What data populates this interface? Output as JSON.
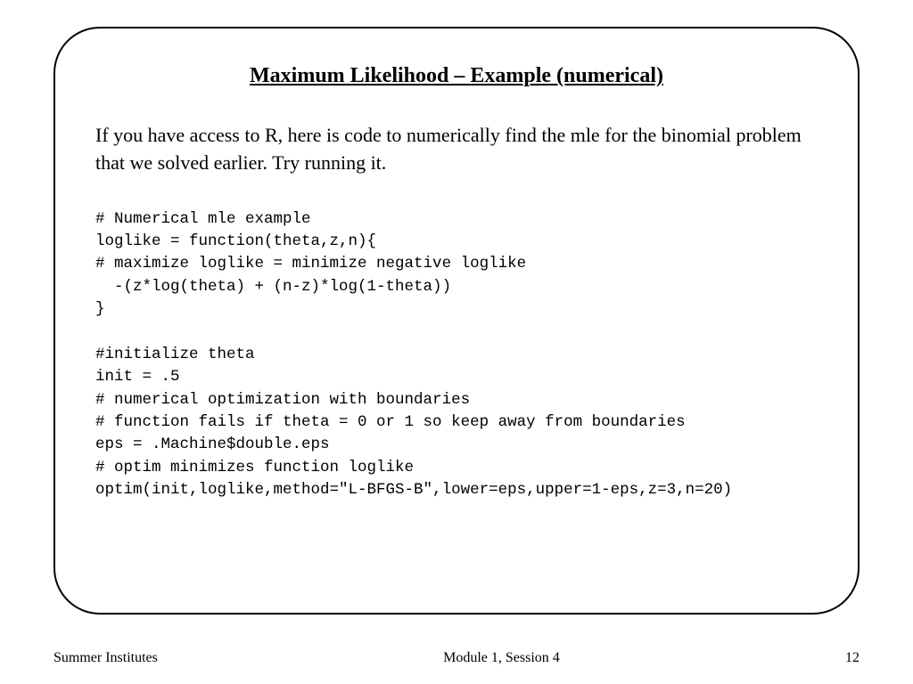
{
  "slide": {
    "title": "Maximum Likelihood – Example (numerical)",
    "intro": "If you have access to R, here is code to numerically find the mle for the binomial problem that we solved earlier. Try running it.",
    "code": "# Numerical mle example\nloglike = function(theta,z,n){\n# maximize loglike = minimize negative loglike\n  -(z*log(theta) + (n-z)*log(1-theta))\n}\n\n#initialize theta\ninit = .5\n# numerical optimization with boundaries\n# function fails if theta = 0 or 1 so keep away from boundaries\neps = .Machine$double.eps\n# optim minimizes function loglike\noptim(init,loglike,method=\"L-BFGS-B\",lower=eps,upper=1-eps,z=3,n=20)"
  },
  "footer": {
    "left": "Summer Institutes",
    "center": "Module 1, Session 4",
    "right": "12"
  }
}
